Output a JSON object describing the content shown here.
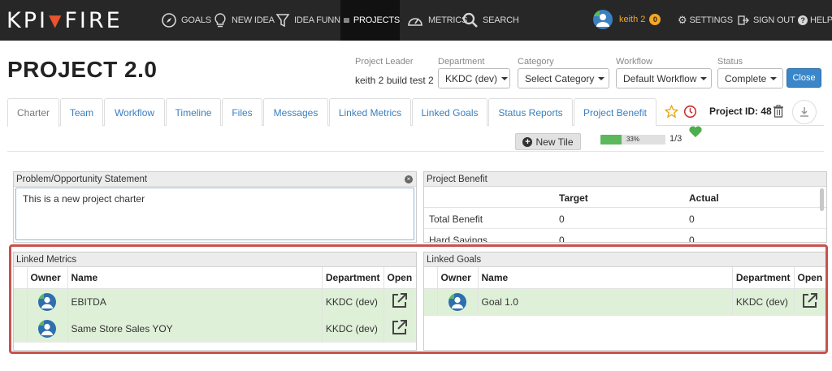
{
  "nav": {
    "logo_left": "KPI",
    "logo_right": "FIRE",
    "items": [
      {
        "label": "Goals",
        "icon": "compass-icon"
      },
      {
        "label": "New Idea",
        "icon": "lightbulb-icon"
      },
      {
        "label": "Idea Funnel",
        "icon": "funnel-icon"
      },
      {
        "label": "Projects",
        "icon": "server-stack-icon",
        "active": true
      },
      {
        "label": "Metrics",
        "icon": "gauge-icon"
      },
      {
        "label": "Search",
        "icon": "search-icon"
      }
    ],
    "user_name": "keith 2",
    "notification_count": "0",
    "settings_label": "Settings",
    "signout_label": "Sign Out",
    "help_label": "Help"
  },
  "header": {
    "title": "PROJECT 2.0",
    "leader_label": "Project Leader",
    "leader_value": "keith 2 build test 2",
    "department_label": "Department",
    "department_value": "KKDC (dev)",
    "category_label": "Category",
    "category_value": "Select Category",
    "workflow_label": "Workflow",
    "workflow_value": "Default Workflow",
    "status_label": "Status",
    "status_value": "Complete",
    "close_label": "Close"
  },
  "tabs": [
    {
      "label": "Charter",
      "active": true
    },
    {
      "label": "Team"
    },
    {
      "label": "Workflow"
    },
    {
      "label": "Timeline"
    },
    {
      "label": "Files"
    },
    {
      "label": "Messages"
    },
    {
      "label": "Linked Metrics"
    },
    {
      "label": "Linked Goals"
    },
    {
      "label": "Status Reports"
    },
    {
      "label": "Project Benefit"
    }
  ],
  "project_id": "Project ID: 48",
  "tiles": {
    "new_tile_label": "New Tile",
    "progress_percent": 33,
    "progress_text": "33%",
    "progress_count": "1/3"
  },
  "problem_panel": {
    "title": "Problem/Opportunity Statement",
    "text": "This is a new project charter"
  },
  "benefit_panel": {
    "title": "Project Benefit",
    "col_target": "Target",
    "col_actual": "Actual",
    "rows": [
      {
        "label": "Total Benefit",
        "target": "0",
        "actual": "0"
      },
      {
        "label": "Hard Savings",
        "target": "0",
        "actual": "0"
      }
    ]
  },
  "metrics_panel": {
    "title": "Linked Metrics",
    "columns": [
      "Owner",
      "Name",
      "Department",
      "Open"
    ],
    "rows": [
      {
        "name": "EBITDA",
        "department": "KKDC (dev)"
      },
      {
        "name": "Same Store Sales YOY",
        "department": "KKDC (dev)"
      }
    ]
  },
  "goals_panel": {
    "title": "Linked Goals",
    "columns": [
      "Owner",
      "Name",
      "Department",
      "Open"
    ],
    "rows": [
      {
        "name": "Goal 1.0",
        "department": "KKDC (dev)"
      }
    ]
  },
  "colors": {
    "nav_bg": "#272727",
    "accent_blue": "#3a86c8",
    "row_green": "#dff0d8",
    "highlight_red": "#c9514d",
    "progress_green": "#5cb85c"
  }
}
